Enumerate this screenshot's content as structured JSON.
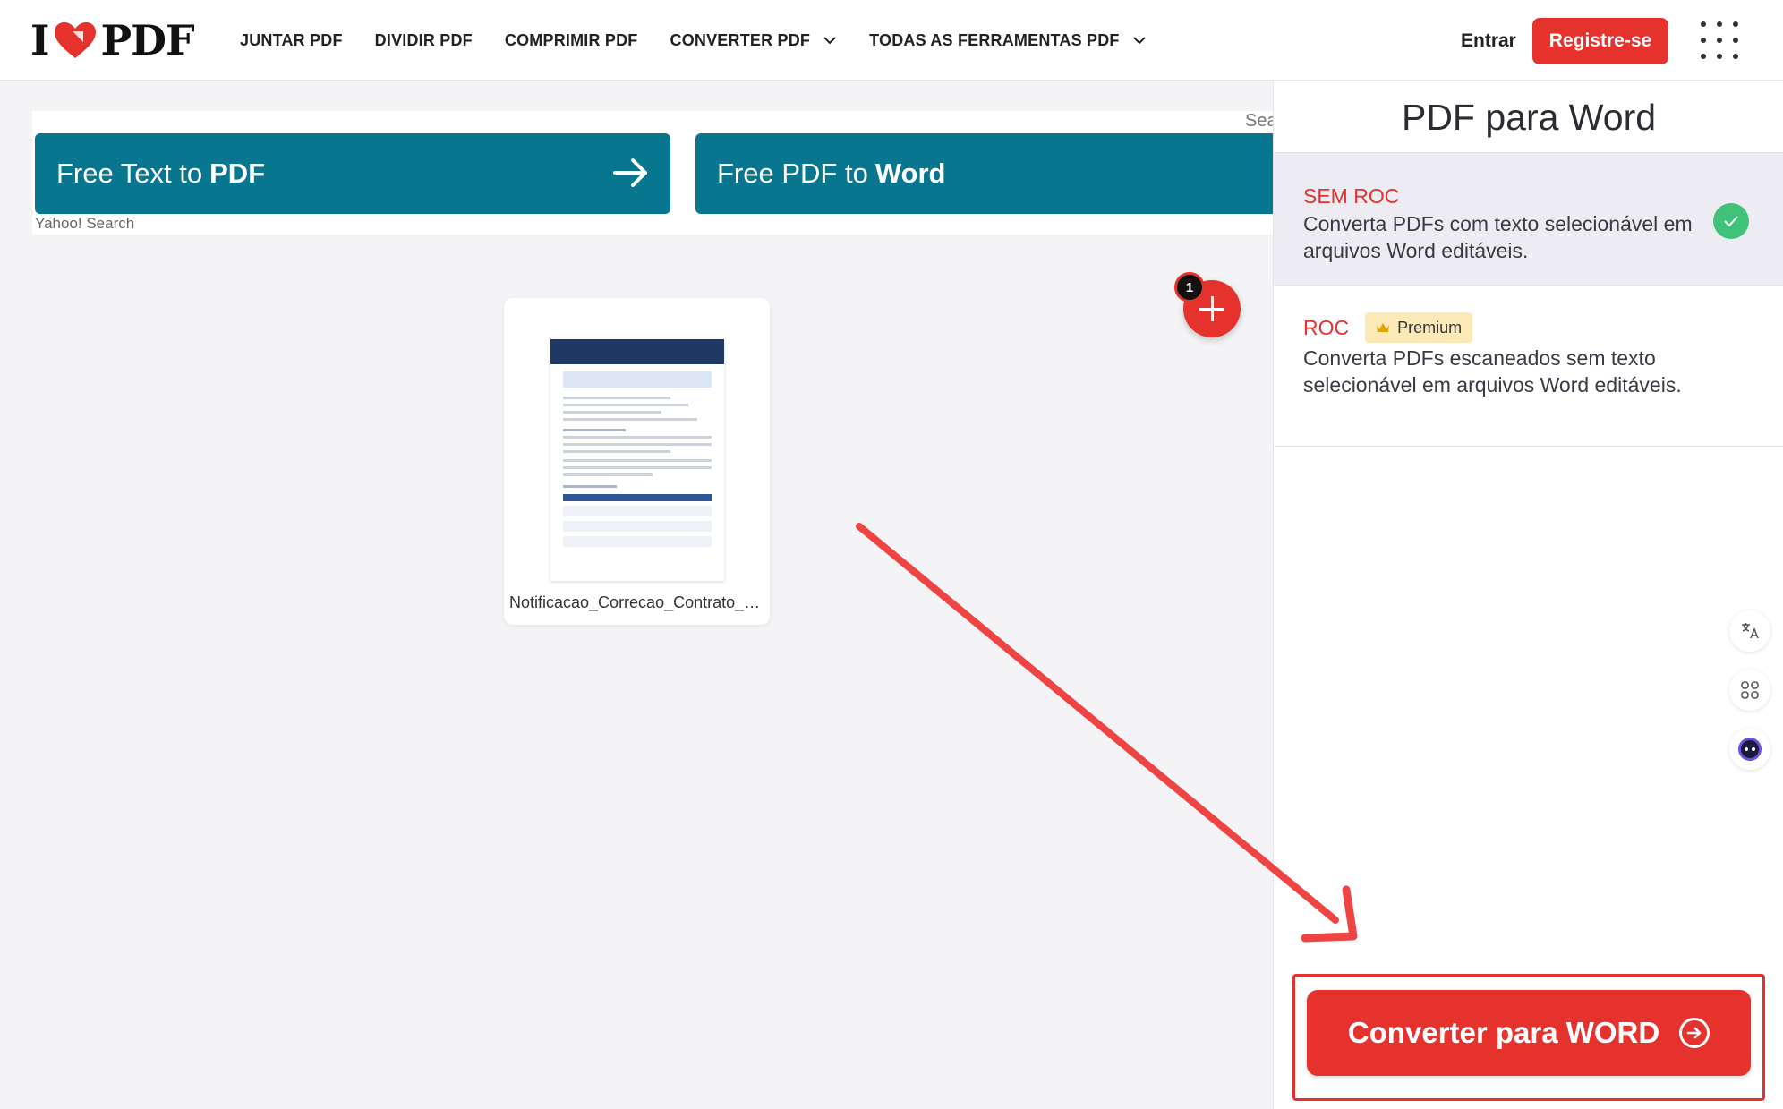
{
  "header": {
    "logo_i": "I",
    "logo_pdf": "PDF",
    "nav": [
      "JUNTAR PDF",
      "DIVIDIR PDF",
      "COMPRIMIR PDF",
      "CONVERTER PDF",
      "TODAS AS FERRAMENTAS PDF"
    ],
    "login": "Entrar",
    "register": "Registre-se"
  },
  "ad": {
    "btn1_plain": "Free Text to",
    "btn1_bold": "PDF",
    "btn2_plain": "Free PDF to",
    "btn2_bold": "Word",
    "search_cut": "Sea",
    "provider": "Yahoo! Search"
  },
  "file": {
    "name": "Notificacao_Correcao_Contrato_Modelo.pdf",
    "count": "1"
  },
  "sidebar": {
    "title": "PDF para Word",
    "options": [
      {
        "title": "SEM ROC",
        "desc": "Converta PDFs com texto selecionável em arquivos Word editáveis.",
        "selected": true
      },
      {
        "title": "ROC",
        "badge": "Premium",
        "desc": "Converta PDFs escaneados sem texto selecionável em arquivos Word editáveis.",
        "selected": false
      }
    ],
    "convert": "Converter para WORD"
  },
  "colors": {
    "brand_red": "#e5322d",
    "ad_teal": "#097690",
    "check_green": "#41c27a"
  },
  "icons": [
    "heart-logo-icon",
    "chevron-down-icon",
    "apps-grid-icon",
    "arrow-right-icon",
    "plus-icon",
    "check-icon",
    "crown-icon",
    "translate-icon",
    "apps-icon",
    "assistant-icon",
    "circle-arrow-right-icon"
  ]
}
